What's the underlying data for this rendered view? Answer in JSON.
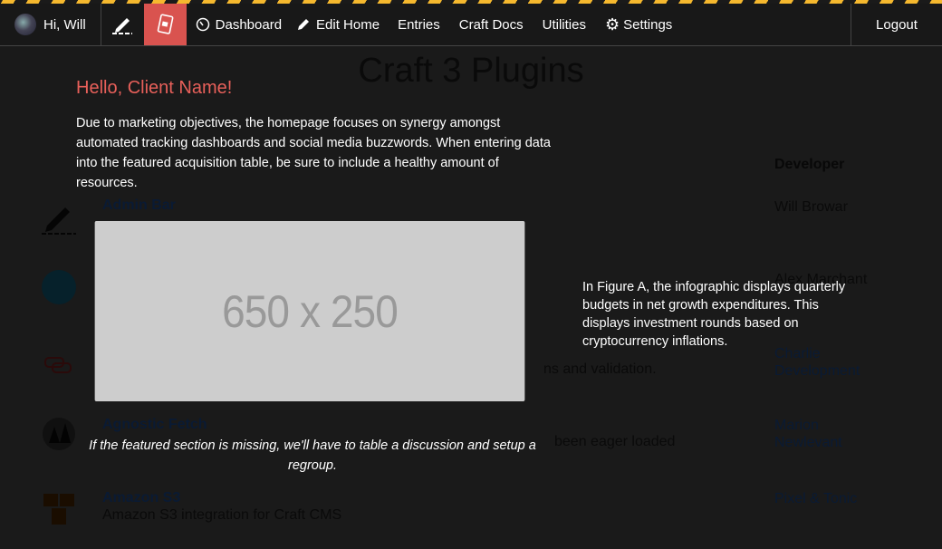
{
  "nav": {
    "greeting": "Hi, Will",
    "items": [
      {
        "label": "Dashboard",
        "icon": "gauge-icon"
      },
      {
        "label": "Edit Home",
        "icon": "pencil-icon"
      },
      {
        "label": "Entries"
      },
      {
        "label": "Craft Docs"
      },
      {
        "label": "Utilities"
      },
      {
        "label": "Settings",
        "icon": "gear-icon"
      }
    ],
    "logout": "Logout",
    "active_accent": "#d9534f",
    "stripe_color": "#f5b82e"
  },
  "page": {
    "title": "Craft 3 Plugins",
    "developer_header": "Developer",
    "rows": [
      {
        "name": "Admin Bar",
        "desc": "",
        "developer": "Will Browar"
      },
      {
        "name": "",
        "desc": "",
        "developer": "Alex Marchant"
      },
      {
        "name": "",
        "desc": "ns and validation.",
        "developer": "Charlie Development"
      },
      {
        "name": "Agnostic Fetch",
        "desc": "been eager loaded",
        "developer": "Marion Newlevant"
      },
      {
        "name": "Amazon S3",
        "desc": "Amazon S3 integration for Craft CMS",
        "developer": "Pixel & Tonic"
      }
    ]
  },
  "overlay": {
    "heading": "Hello, Client Name!",
    "intro": "Due to marketing objectives, the homepage focuses on synergy amongst automated tracking dashboards and social media buzzwords. When entering data into the featured acquisition table, be sure to include a healthy amount of resources.",
    "image_placeholder": "650 x 250",
    "caption": "If the featured section is missing, we'll have to table a discussion and setup a regroup.",
    "side_text": "In Figure A, the infographic displays quarterly budgets in net growth expenditures. This displays investment rounds based on cryptocurrency inflations.",
    "heading_color": "#e8605a"
  }
}
